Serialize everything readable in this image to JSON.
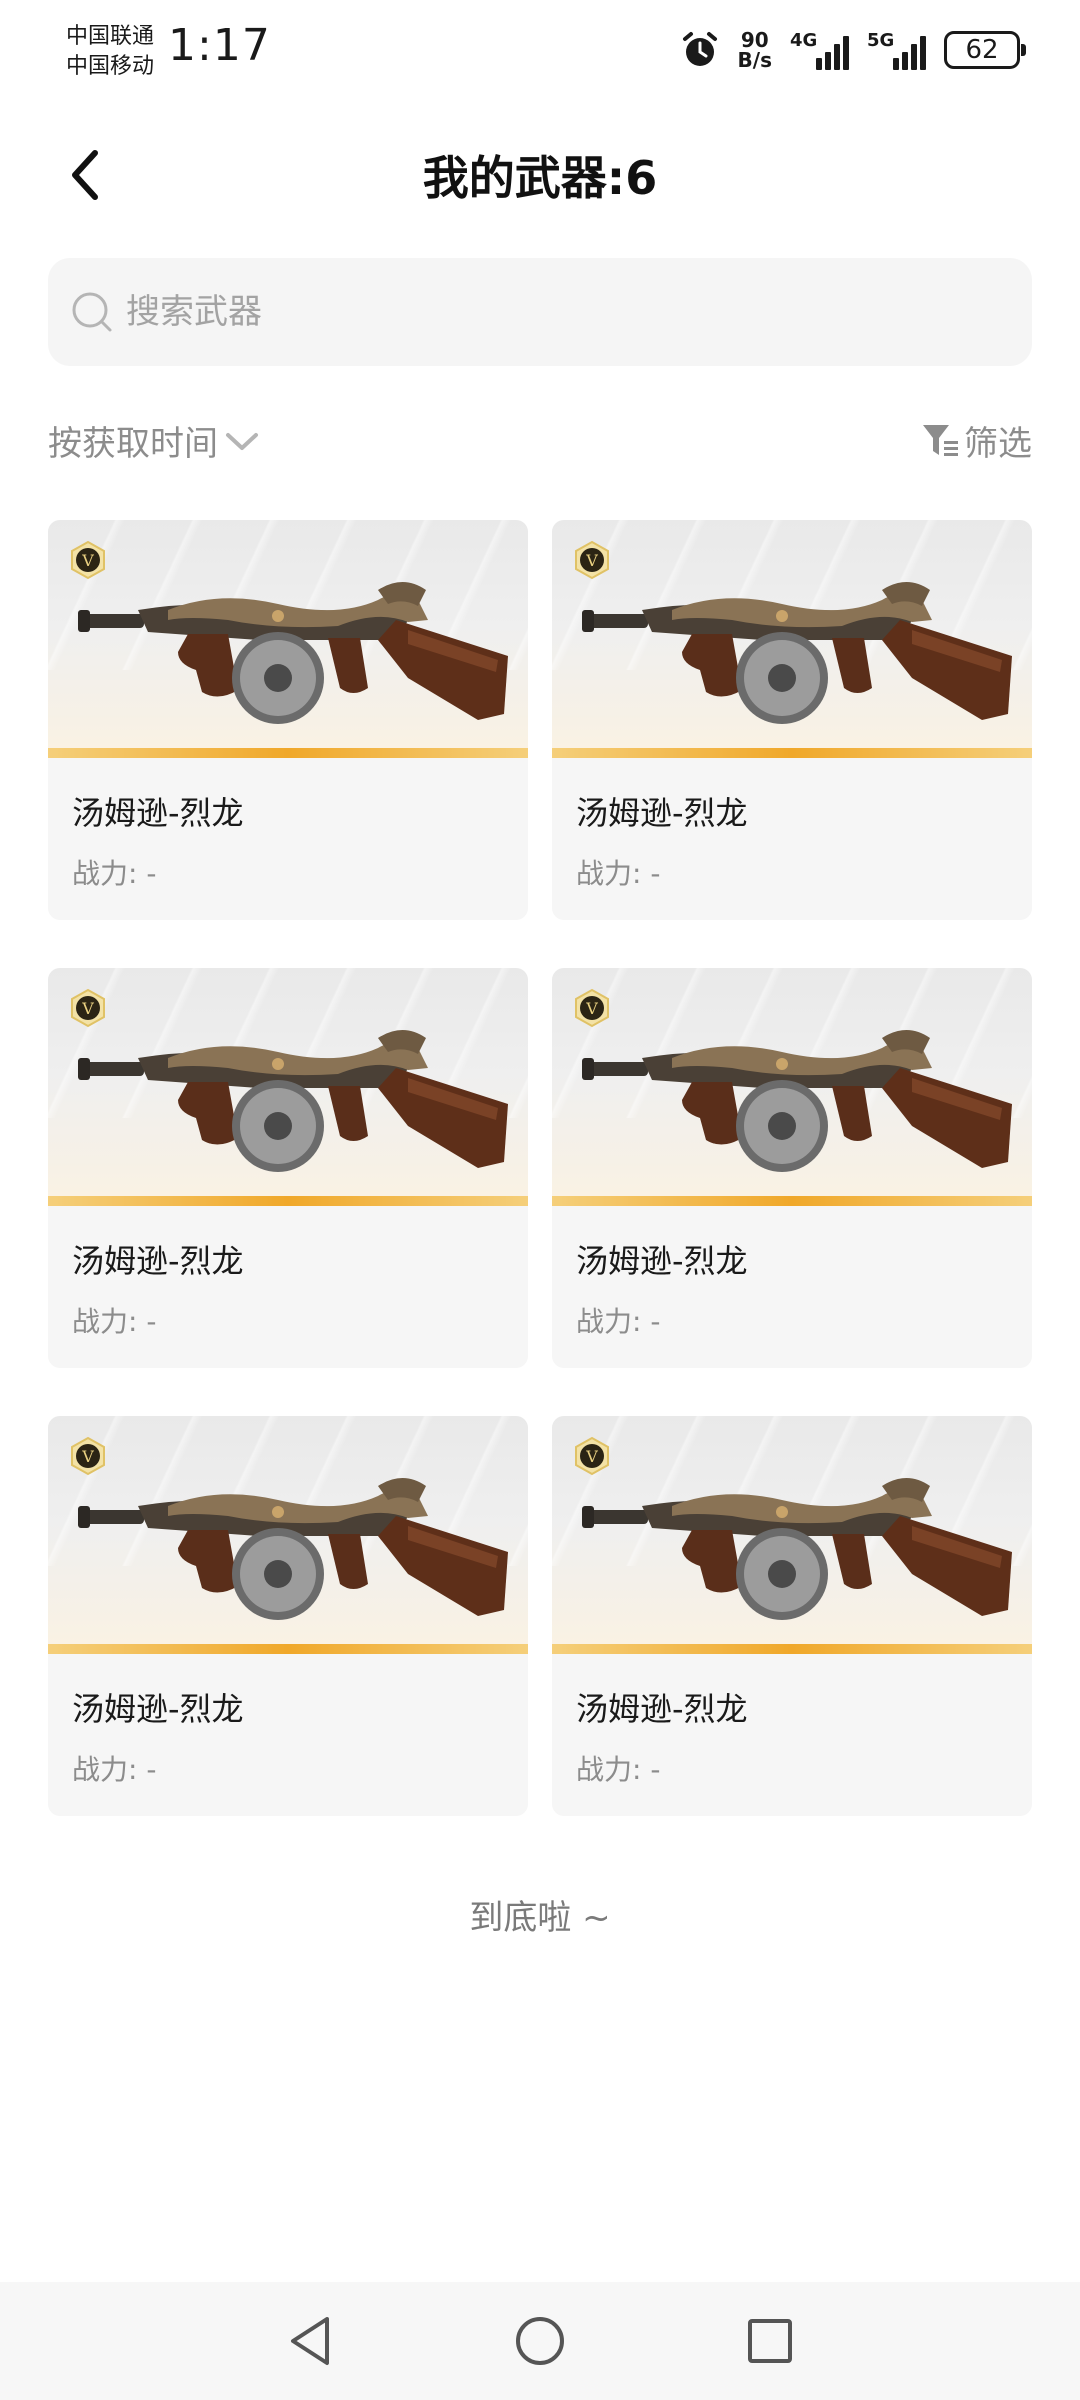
{
  "status_bar": {
    "carrier_1": "中国联通",
    "carrier_2": "中国移动",
    "time": "1:17",
    "net_speed_value": "90",
    "net_speed_unit": "B/s",
    "signal_1_label": "4G",
    "signal_2_label": "5G",
    "battery": "62"
  },
  "header": {
    "title": "我的武器:6"
  },
  "search": {
    "placeholder": "搜索武器"
  },
  "sort": {
    "label": "按获取时间"
  },
  "filter": {
    "label": "筛选"
  },
  "badge": {
    "letter": "V"
  },
  "weapons": [
    {
      "name": "汤姆逊-烈龙",
      "power": "战力: -"
    },
    {
      "name": "汤姆逊-烈龙",
      "power": "战力: -"
    },
    {
      "name": "汤姆逊-烈龙",
      "power": "战力: -"
    },
    {
      "name": "汤姆逊-烈龙",
      "power": "战力: -"
    },
    {
      "name": "汤姆逊-烈龙",
      "power": "战力: -"
    },
    {
      "name": "汤姆逊-烈龙",
      "power": "战力: -"
    }
  ],
  "footer": {
    "end_text": "到底啦 ~"
  },
  "colors": {
    "accent_gold": "#f0a82a",
    "muted_text": "#8c8c8c",
    "card_bg": "#f6f6f6"
  }
}
